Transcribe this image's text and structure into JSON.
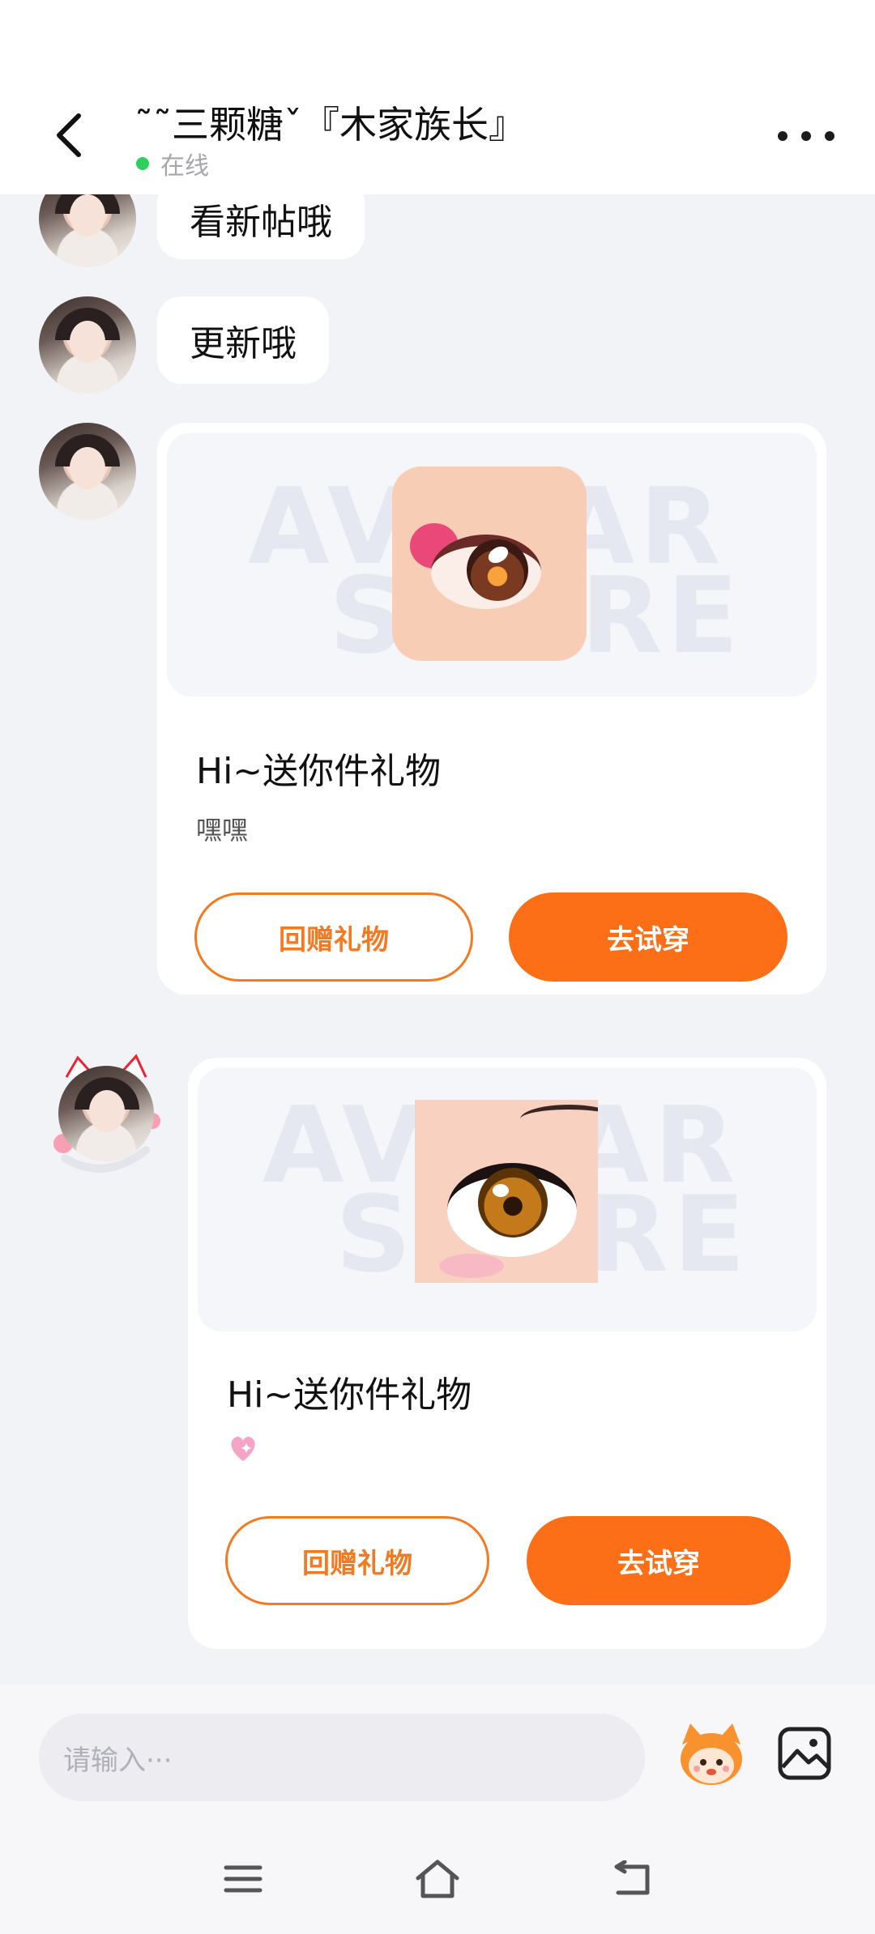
{
  "header": {
    "title": "˜˜三颗糖ˇ『木家族长』",
    "status": "在线"
  },
  "messages": {
    "text1": "看新帖哦",
    "text2": "更新哦"
  },
  "gift1": {
    "watermark_top": "AVATAR",
    "watermark_bottom": "STORE",
    "title": "Hi~送你件礼物",
    "message": "嘿嘿",
    "return_gift_label": "回赠礼物",
    "try_on_label": "去试穿"
  },
  "gift2": {
    "watermark_top": "AVATAR",
    "watermark_bottom": "STORE",
    "title": "Hi~送你件礼物",
    "message_icon": "sparkling-heart-icon",
    "return_gift_label": "回赠礼物",
    "try_on_label": "去试穿"
  },
  "input": {
    "placeholder": "请输入···"
  },
  "colors": {
    "accent": "#fd6f17",
    "online": "#2fcf5b",
    "background": "#f2f3f6"
  }
}
